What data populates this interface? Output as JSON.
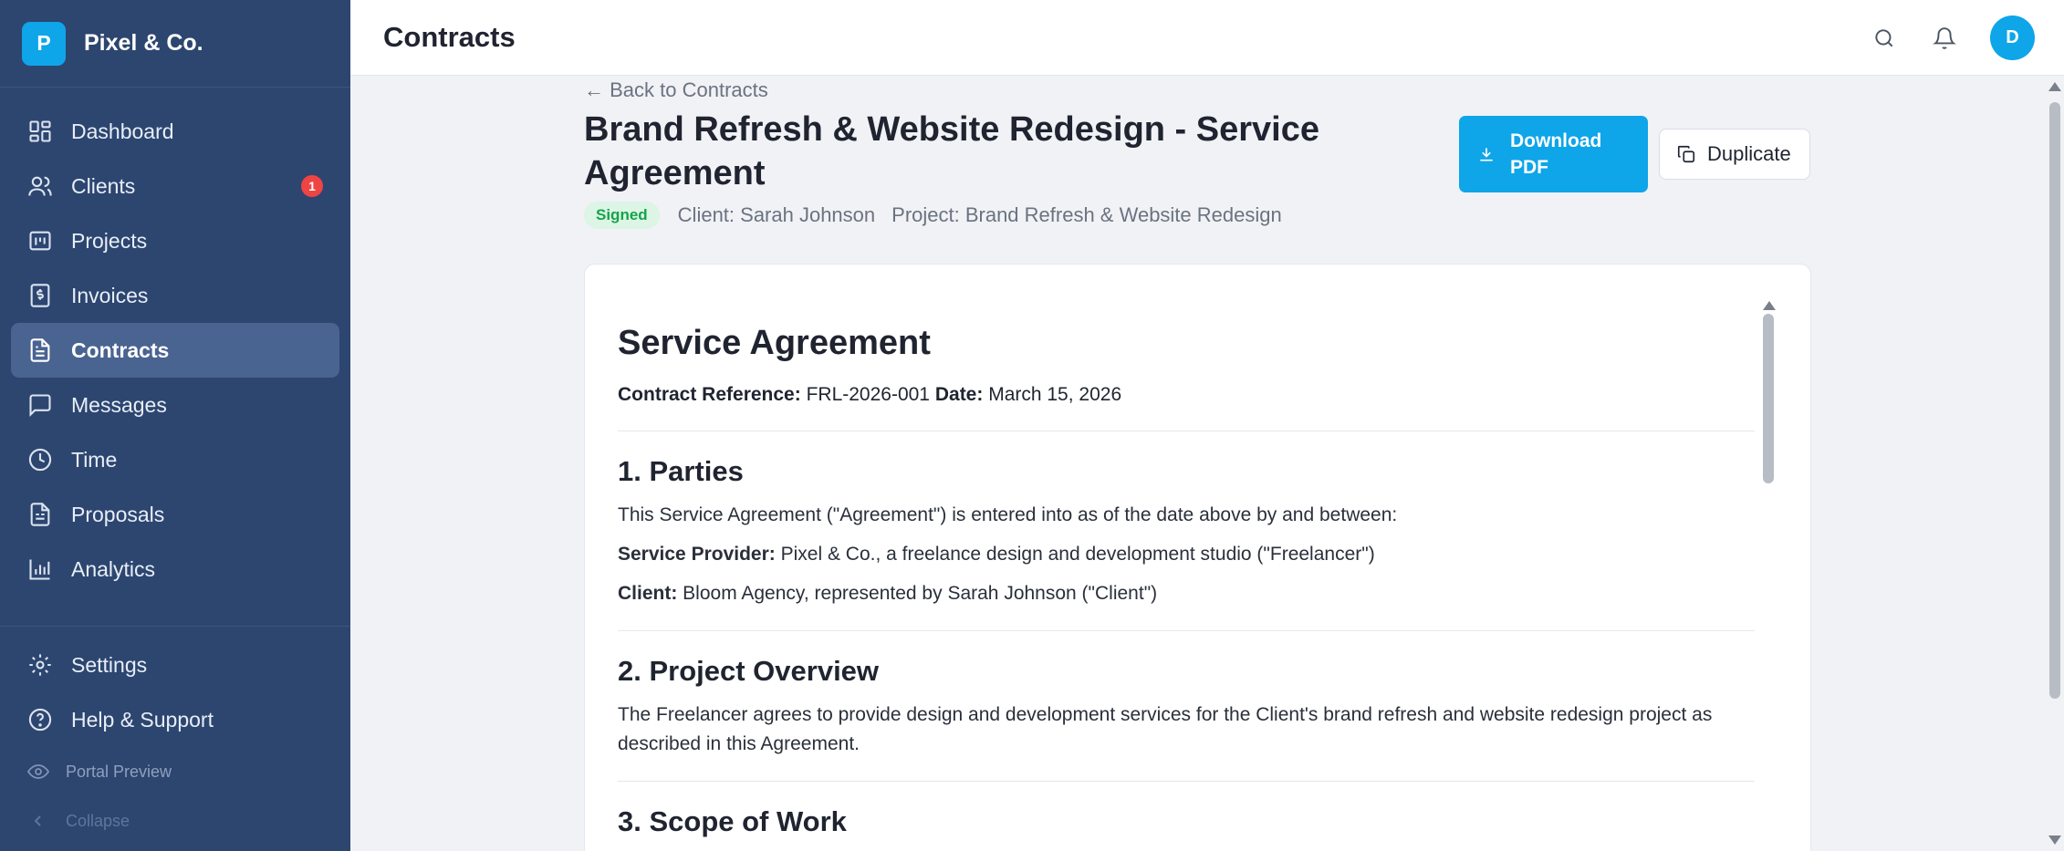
{
  "brand": {
    "logo_letter": "P",
    "name": "Pixel & Co."
  },
  "sidebar": {
    "items": [
      {
        "label": "Dashboard",
        "icon": "dashboard-icon"
      },
      {
        "label": "Clients",
        "icon": "users-icon",
        "badge": "1"
      },
      {
        "label": "Projects",
        "icon": "projects-icon"
      },
      {
        "label": "Invoices",
        "icon": "invoice-icon"
      },
      {
        "label": "Contracts",
        "icon": "document-icon",
        "active": true
      },
      {
        "label": "Messages",
        "icon": "message-icon"
      },
      {
        "label": "Time",
        "icon": "clock-icon"
      },
      {
        "label": "Proposals",
        "icon": "proposal-icon"
      },
      {
        "label": "Analytics",
        "icon": "chart-icon"
      }
    ],
    "bottom": {
      "settings": "Settings",
      "help": "Help & Support",
      "portal_preview": "Portal Preview",
      "collapse": "Collapse"
    }
  },
  "header": {
    "title": "Contracts",
    "avatar_letter": "D"
  },
  "contract": {
    "back_label": "← Back to Contracts",
    "title": "Brand Refresh & Website Redesign - Service Agreement",
    "status": "Signed",
    "client": "Client: Sarah Johnson",
    "project": "Project: Brand Refresh & Website Redesign",
    "download_label": "Download PDF",
    "duplicate_label": "Duplicate"
  },
  "document": {
    "heading": "Service Agreement",
    "ref_label": "Contract Reference:",
    "ref_value": "FRL-2026-001",
    "date_label": "Date:",
    "date_value": "March 15, 2026",
    "sections": [
      {
        "title": "1. Parties",
        "intro": "This Service Agreement (\"Agreement\") is entered into as of the date above by and between:",
        "provider_label": "Service Provider:",
        "provider_text": "Pixel & Co., a freelance design and development studio (\"Freelancer\")",
        "client_label": "Client:",
        "client_text": "Bloom Agency, represented by Sarah Johnson (\"Client\")"
      },
      {
        "title": "2. Project Overview",
        "text": "The Freelancer agrees to provide design and development services for the Client's brand refresh and website redesign project as described in this Agreement."
      },
      {
        "title": "3. Scope of Work"
      }
    ]
  },
  "colors": {
    "sidebar": "#2d4670",
    "accent": "#0ea5e9",
    "signed": "#16a34a",
    "badge": "#ef4444"
  }
}
